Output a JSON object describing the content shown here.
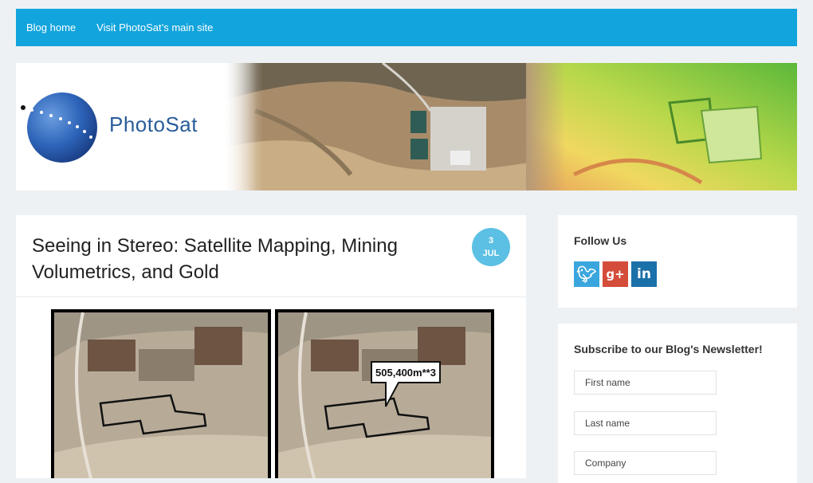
{
  "nav": {
    "items": [
      {
        "label": "Blog home"
      },
      {
        "label": "Visit PhotoSat’s main site"
      }
    ]
  },
  "banner": {
    "logo_text": "PhotoSat"
  },
  "post": {
    "title": "Seeing in Stereo: Satellite Mapping, Mining Volumetrics, and Gold",
    "date_day": "3",
    "date_month": "JUL",
    "figure_callout": "505,400m**3"
  },
  "sidebar": {
    "follow_title": "Follow Us",
    "social": [
      "twitter-icon",
      "google-plus-icon",
      "linkedin-icon"
    ],
    "subscribe_title": "Subscribe to our Blog's Newsletter!",
    "fields": {
      "first_name": "First name",
      "last_name": "Last name",
      "company": "Company"
    }
  },
  "colors": {
    "nav_bg": "#12a4dc",
    "date_badge": "#5bc0e3",
    "background": "#eef1f4"
  }
}
